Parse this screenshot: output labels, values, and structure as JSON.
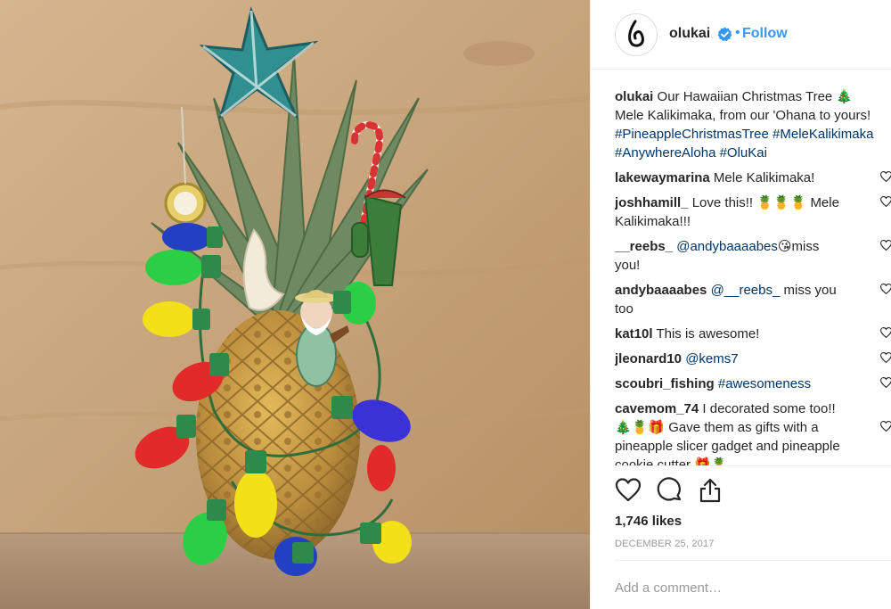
{
  "post": {
    "username": "olukai",
    "follow_label": "Follow",
    "separator": "•",
    "avatar_text": "OluKai"
  },
  "caption": {
    "username": "olukai",
    "line1": "Our Hawaiian Christmas Tree 🎄",
    "line2": "Mele Kalikimaka, from our 'Ohana to yours!",
    "line3": "#PineappleChristmasTree #MeleKalikimaka",
    "line4": "#AnywhereAloha #OluKai"
  },
  "comments": [
    {
      "username": "lakewaymarina",
      "line1": "Mele Kalikimaka!"
    },
    {
      "username": "joshhamill_",
      "line1": "Love this!! 🍍🍍🍍 Mele",
      "line2": "Kalikimaka!!!"
    },
    {
      "username": "__reebs_",
      "mention": "@andybaaaabes",
      "line1": "😘miss",
      "line2": "you!"
    },
    {
      "username": "andybaaaabes",
      "mention": "@__reebs_",
      "line1": "miss you",
      "line2": "too"
    },
    {
      "username": "kat10l",
      "line1": "This is awesome!"
    },
    {
      "username": "jleonard10",
      "mention": "@kems7"
    },
    {
      "username": "scoubri_fishing",
      "mention": "#awesomeness"
    },
    {
      "username": "cavemom_74",
      "line1": "I decorated some too!!",
      "line2": "🎄🍍🎁 Gave them as gifts with a",
      "line3": "pineapple slicer gadget and pineapple",
      "line4": "cookie cutter 🎁🍍"
    }
  ],
  "likes": "1,746 likes",
  "date": "DECEMBER 25, 2017",
  "add_comment_placeholder": "Add a comment…",
  "colors": {
    "link": "#3897f0",
    "hashtag": "#003569",
    "text": "#262626",
    "muted": "#999999"
  },
  "icons": [
    "verified-badge-icon",
    "heart-icon",
    "comment-icon",
    "share-icon",
    "comment-heart-icon"
  ]
}
